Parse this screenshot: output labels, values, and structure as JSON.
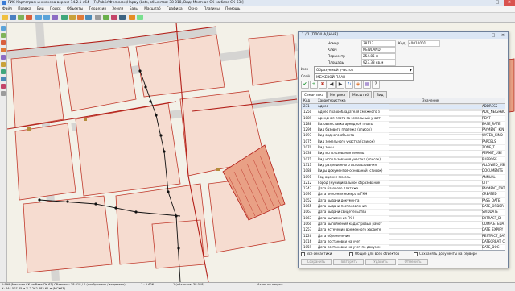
{
  "window": {
    "title": "ГИС Картограф инженера версия 14.2.1 x64 - [F:\\Public\\Филимон\\Нарву (Lots, объектов: 38 018, Вид: Местная СК на базе СК-63)]"
  },
  "menu": [
    "Файл",
    "Правка",
    "Вид",
    "Поиск",
    "Объекты",
    "Геодезия",
    "Земля",
    "Базы",
    "Масштаб",
    "Графика",
    "Окно",
    "Плагины",
    "Помощь"
  ],
  "dialog": {
    "title": "1 / 1 [ПЛОЩАДНЫЕ]",
    "props": [
      {
        "label": "Номер",
        "value": "38113",
        "extra_label": "Код",
        "extra_value": "40010001"
      },
      {
        "label": "Ключ",
        "value": "NEWLAND"
      },
      {
        "label": "Периметр",
        "value": "254.85 м"
      },
      {
        "label": "Площадь",
        "value": "923.33 кв.м"
      }
    ],
    "type_label": "Имя",
    "type_value": "Образуемый участок",
    "layer_label": "Слой",
    "layer_value": "МЕЖЕВОЙ ПЛАН",
    "tabs": [
      "Семантика",
      "Метрика",
      "Масштаб",
      "Вид"
    ],
    "grid_headers": {
      "code": "Код",
      "char": "Характеристика",
      "value": "Значение",
      "key": ""
    },
    "rows": [
      {
        "code": "231",
        "char": "Адрес",
        "key": "ADDRESS"
      },
      {
        "code": "1250",
        "char": "Адрес правообладателя смежного з",
        "key": "ADR_NEIGHBO"
      },
      {
        "code": "1089",
        "char": "Арендная плата за земельный участ",
        "key": "RENT"
      },
      {
        "code": "1288",
        "char": "Базовая ставка арендной платы",
        "key": "BASE_RATE"
      },
      {
        "code": "1296",
        "char": "Вид базового платежа (список)",
        "key": "PAYMENT_KIN"
      },
      {
        "code": "1097",
        "char": "Вид водного объекта",
        "key": "WATER_KIND"
      },
      {
        "code": "1075",
        "char": "Вид земельного участка (список)",
        "key": "PARCELS"
      },
      {
        "code": "1070",
        "char": "Вид зоны",
        "key": "ZONE_T"
      },
      {
        "code": "1038",
        "char": "Вид использования земель",
        "key": "PERMIT_USE"
      },
      {
        "code": "1071",
        "char": "Вид использования участка (список)",
        "key": "PURPOSE"
      },
      {
        "code": "1311",
        "char": "Вид разрешенного использования",
        "key": "ALLOWED_USE"
      },
      {
        "code": "1088",
        "char": "Виды документов-оснований (список)",
        "key": "DOCUMENTS"
      },
      {
        "code": "1091",
        "char": "Год оценки земель",
        "key": "ANNUAL"
      },
      {
        "code": "1212",
        "char": "Город (муниципальное образование",
        "key": "CITY"
      },
      {
        "code": "1247",
        "char": "Дата базового платежа",
        "key": "PAYMENT_DAT"
      },
      {
        "code": "1091",
        "char": "Дата внесения номера в ГКН",
        "key": "CREATED"
      },
      {
        "code": "1052",
        "char": "Дата выдачи документа",
        "key": "PASS_DATE"
      },
      {
        "code": "1065",
        "char": "Дата выдачи постановления",
        "key": "DATE_ORDER"
      },
      {
        "code": "1063",
        "char": "Дата выдачи свидетельства",
        "key": "SVIDDATE"
      },
      {
        "code": "1067",
        "char": "Дата выписки из ГКН",
        "key": "EXTRACT_D"
      },
      {
        "code": "1060",
        "char": "Дата выполнения кадастровых работ",
        "key": "COMPLETEDAT"
      },
      {
        "code": "1257",
        "char": "Дата истечения временного характе",
        "key": "DATE_EXPIRY"
      },
      {
        "code": "1226",
        "char": "Дата обременения",
        "key": "RESTRICT_DATE"
      },
      {
        "code": "1016",
        "char": "Дата постановки на учет",
        "key": "DATECREAT_C"
      },
      {
        "code": "1059",
        "char": "Дата постановки на учет по докумен",
        "key": "DATE_DOC"
      },
      {
        "code": "1251",
        "char": "Дата предоставления сведений ГКН",
        "key": "UPLOAD"
      },
      {
        "code": "1264",
        "char": "Дата снятия с учета",
        "key": "REMOVED"
      }
    ],
    "checks": [
      "Все семантики",
      "Общие для всех объектов",
      "Сохранять документы на сервере"
    ],
    "buttons": [
      "Сохранить",
      "Повторить",
      "Удалить",
      "Отменить"
    ]
  },
  "status": {
    "line1_left": "1:999 (Местная СК на базе СК-63) Объектов: 38 018 / 0 (отображено / выделено)",
    "scale": "1 : 2 626",
    "objects": "1 (объектов: 38 018)",
    "atlas": "Атлас не открыт",
    "coords": "X: 444 507.85 м   Y: 2 262 882.61 м   (МСК63)"
  },
  "colors": {
    "accent": "#3a7bd5",
    "map_bg": "#f3f1e8",
    "parcel_fill": "#f6dcd0",
    "parcel_line": "#c0392b",
    "hatch_fill": "#e9a085"
  }
}
